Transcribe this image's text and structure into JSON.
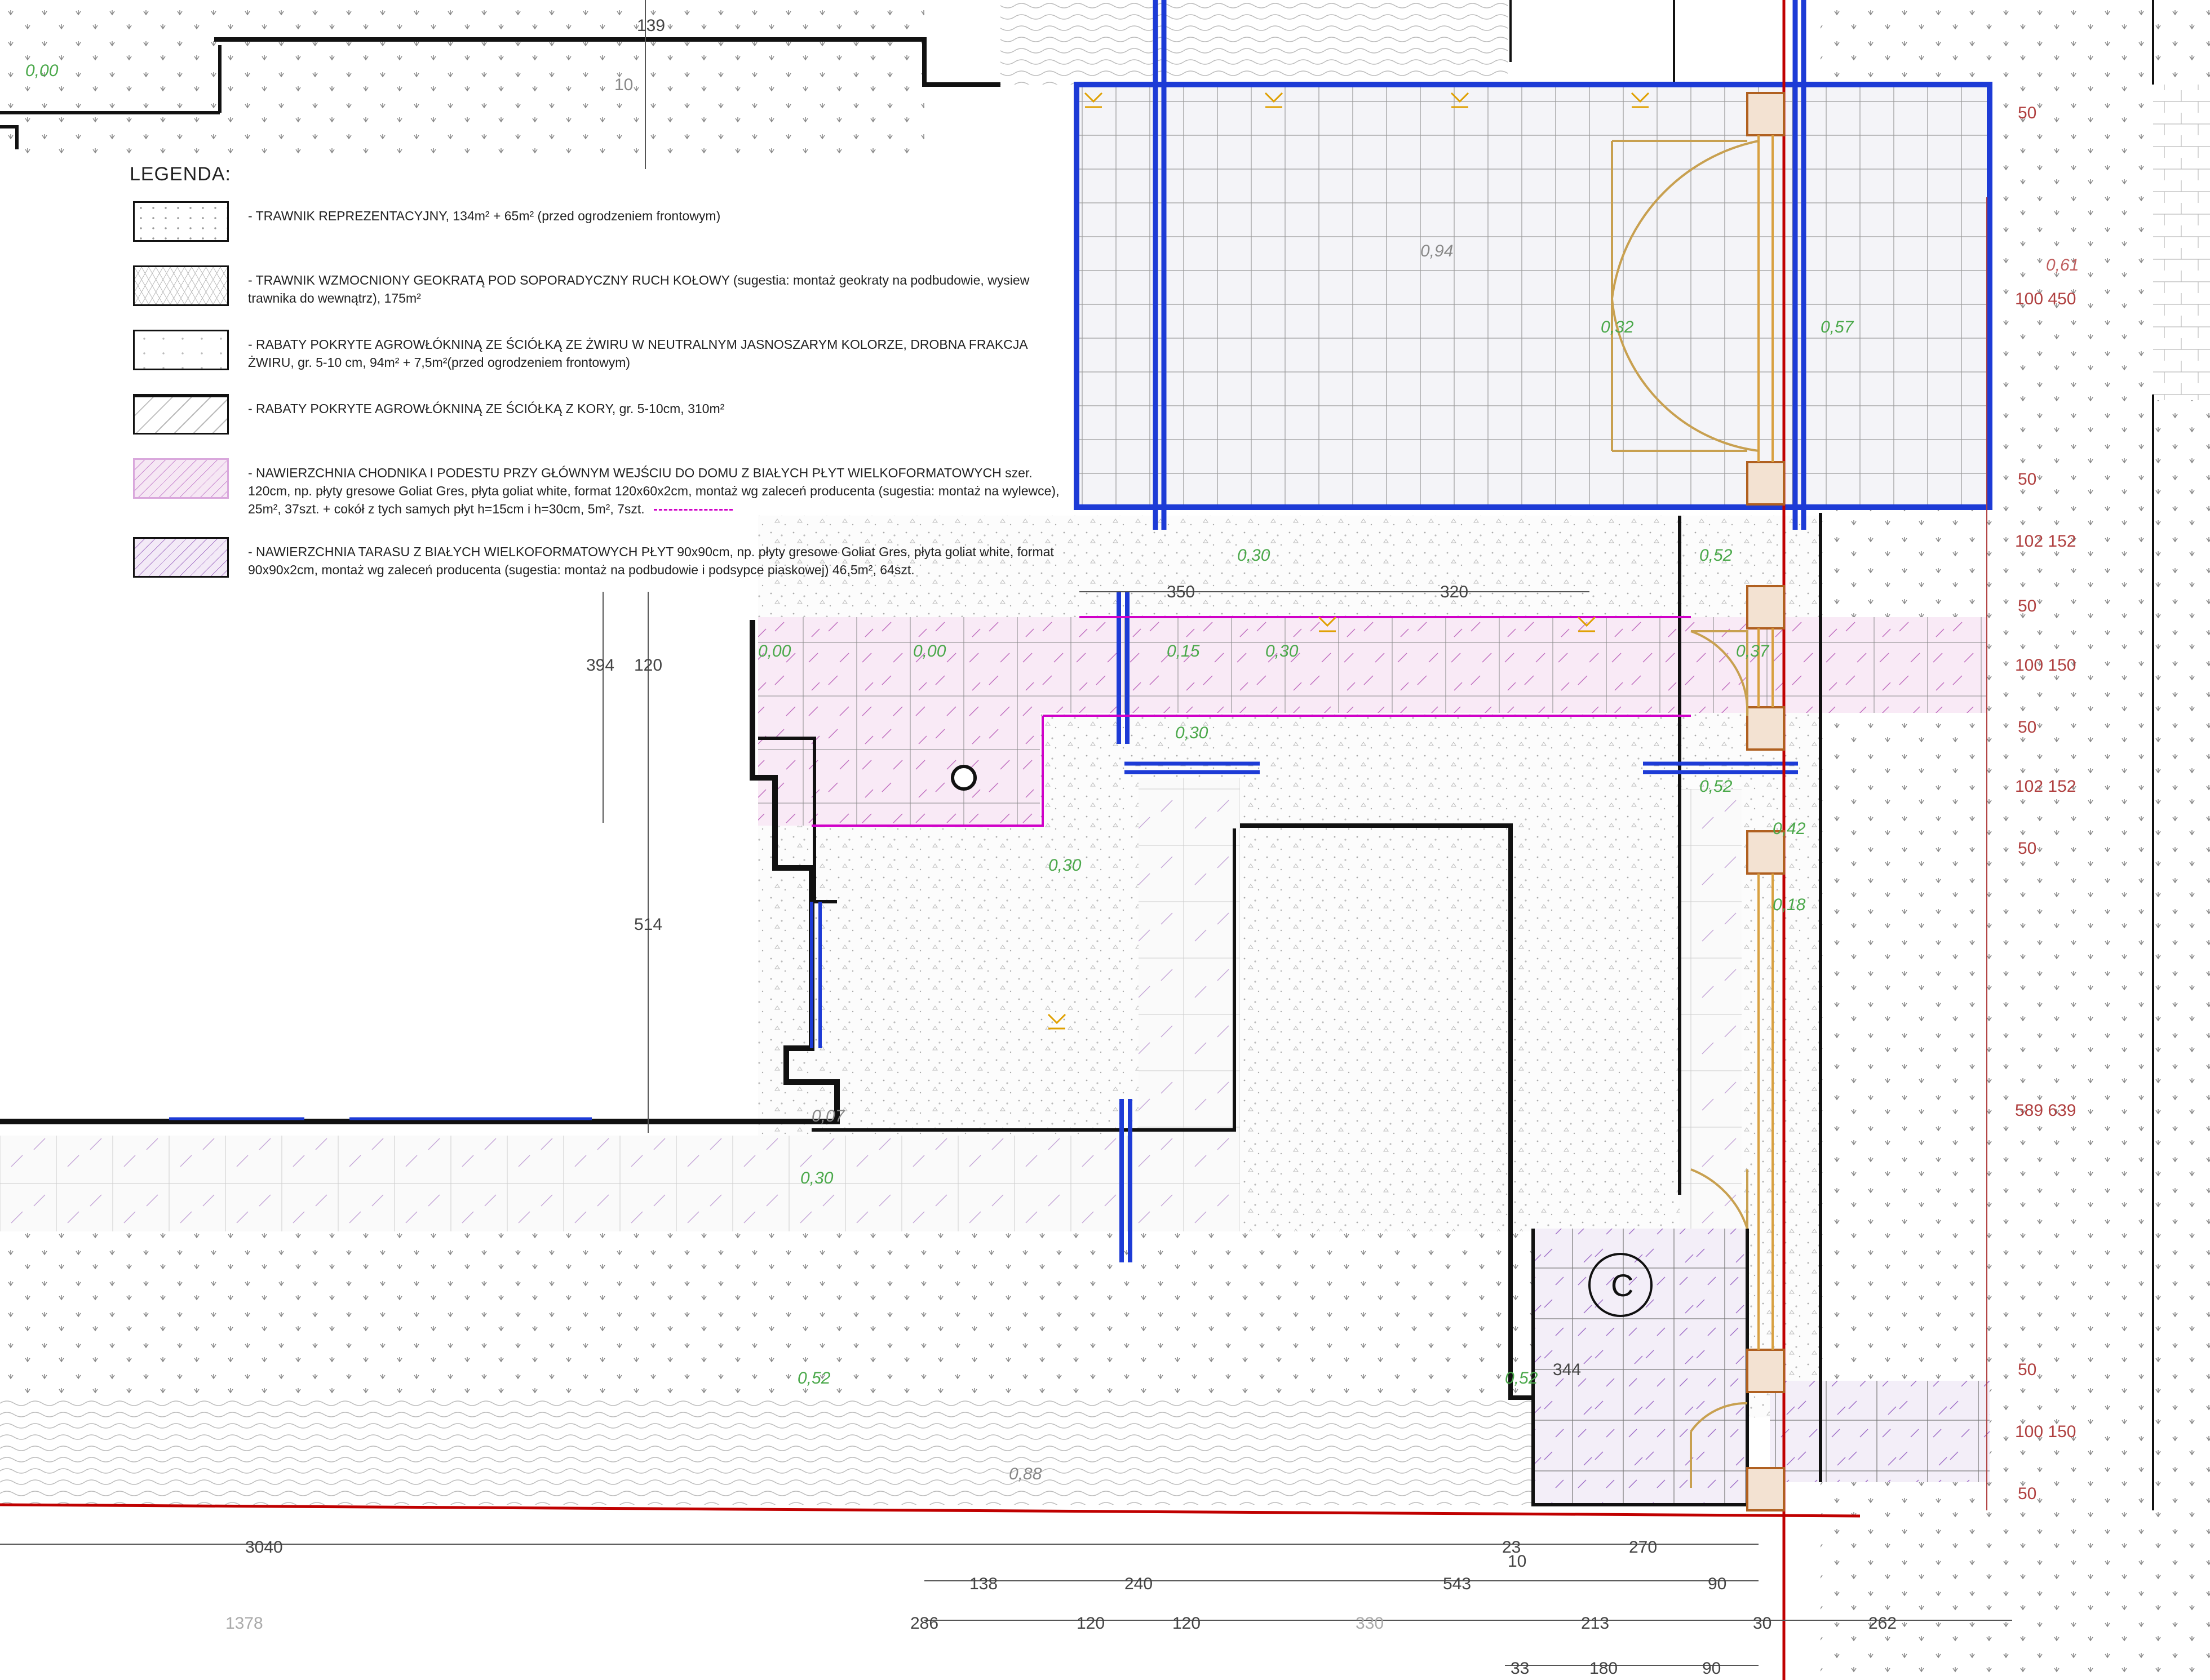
{
  "legend": {
    "title": "LEGENDA:",
    "items": [
      {
        "swatch": "lawn",
        "text": "- TRAWNIK REPREZENTACYJNY, 134m² + 65m² (przed ogrodzeniem frontowym)"
      },
      {
        "swatch": "geokrata",
        "text": "- TRAWNIK WZMOCNIONY GEOKRATĄ POD SOPORADYCZNY RUCH KOŁOWY (sugestia: montaż geokraty na podbudowie, wysiew trawnika do wewnątrz), 175m²"
      },
      {
        "swatch": "gravel",
        "text": "- RABATY POKRYTE AGROWŁÓKNINĄ ZE ŚCIÓŁKĄ ZE ŻWIRU W NEUTRALNYM JASNOSZARYM KOLORZE, DROBNA FRAKCJA ŻWIRU, gr. 5-10 cm, 94m² + 7,5m²(przed ogrodzeniem frontowym)"
      },
      {
        "swatch": "bark",
        "text": "- RABATY POKRYTE AGROWŁÓKNINĄ ZE ŚCIÓŁKĄ Z KORY, gr. 5-10cm, 310m²"
      },
      {
        "swatch": "path",
        "text": "- NAWIERZCHNIA CHODNIKA I PODESTU PRZY GŁÓWNYM WEJŚCIU DO DOMU Z BIAŁYCH PŁYT WIELKOFORMATOWYCH szer. 120cm, np. płyty gresowe Goliat Gres, płyta goliat white, format 120x60x2cm, montaż wg zaleceń producenta (sugestia: montaż na wylewce), 25m², 37szt. + cokół z tych samych płyt h=15cm i h=30cm, 5m², 7szt."
      },
      {
        "swatch": "terrace",
        "text": "- NAWIERZCHNIA TARASU Z BIAŁYCH WIELKOFORMATOWYCH PŁYT 90x90cm, np. płyty gresowe Goliat Gres, płyta goliat white, format 90x90x2cm, montaż wg zaleceń producenta (sugestia: montaż na podbudowie i podsypce piaskowej) 46,5m², 64szt."
      }
    ]
  },
  "levels": {
    "l0a": "0,00",
    "l0b": "0,00",
    "l0c": "0,00",
    "l094": "0,94",
    "l032": "0,32",
    "l057": "0,57",
    "l061": "0,61",
    "l030a": "0,30",
    "l052a": "0,52",
    "l015": "0,15",
    "l030b": "0,30",
    "l037": "0,37",
    "l030c": "0,30",
    "l052b": "0,52",
    "l042": "0,42",
    "l018": "0,18",
    "l030d": "0,30",
    "l007": "0,07",
    "l030e": "0,30",
    "l052c": "0,52",
    "l052d": "0,52",
    "l088": "0,88"
  },
  "dims": {
    "d139": "139",
    "d10a": "10",
    "d350": "350",
    "d320": "320",
    "d394": "394",
    "d120a": "120",
    "d514": "514",
    "d344": "344",
    "d3040": "3040",
    "d23": "23",
    "d10b": "10",
    "d270": "270",
    "d138": "138",
    "d240": "240",
    "d543": "543",
    "d90a": "90",
    "d1378": "1378",
    "d286": "286",
    "d120b": "120",
    "d120c": "120",
    "d330": "330",
    "d213": "213",
    "d30": "30",
    "d262": "262",
    "d33": "33",
    "d180": "180",
    "d90b": "90",
    "r100_450": "100 450",
    "r50a": "50",
    "r50b": "50",
    "r102a": "102 152",
    "r50c": "50",
    "r100_150a": "100 150",
    "r50d": "50",
    "r102b": "102 152",
    "r50e": "50",
    "r589": "589 639",
    "r50f": "50",
    "r100_150b": "100 150",
    "r50g": "50"
  },
  "symbols": {
    "room_c": "C"
  },
  "colors": {
    "wall": "#111111",
    "blue_line": "#1d3bd6",
    "magenta": "#d000c8",
    "red_axis": "#c00000",
    "dim_red": "#b04040",
    "level_green": "#4aa84a",
    "door_gold": "#c8a050"
  }
}
